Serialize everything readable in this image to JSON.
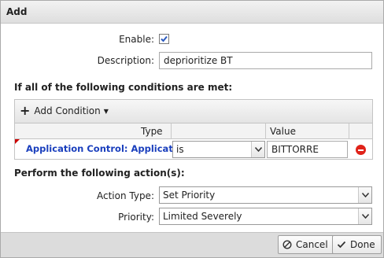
{
  "dialog": {
    "title": "Add"
  },
  "form": {
    "enable_label": "Enable:",
    "enable_checked": true,
    "description_label": "Description:",
    "description_value": "deprioritize BT"
  },
  "conditions": {
    "heading": "If all of the following conditions are met:",
    "add_condition_label": "Add Condition",
    "columns": {
      "type": "Type",
      "operator": "",
      "value": "Value"
    },
    "rows": [
      {
        "type": "Application Control: Application:",
        "operator": "is",
        "value": "BITTORRE"
      }
    ]
  },
  "actions": {
    "heading": "Perform the following action(s):",
    "action_type_label": "Action Type:",
    "action_type_value": "Set Priority",
    "priority_label": "Priority:",
    "priority_value": "Limited Severely"
  },
  "footer": {
    "cancel_label": "Cancel",
    "done_label": "Done"
  },
  "colors": {
    "condition_type_text": "#1a3fbd",
    "remove_icon": "#e0231a"
  }
}
